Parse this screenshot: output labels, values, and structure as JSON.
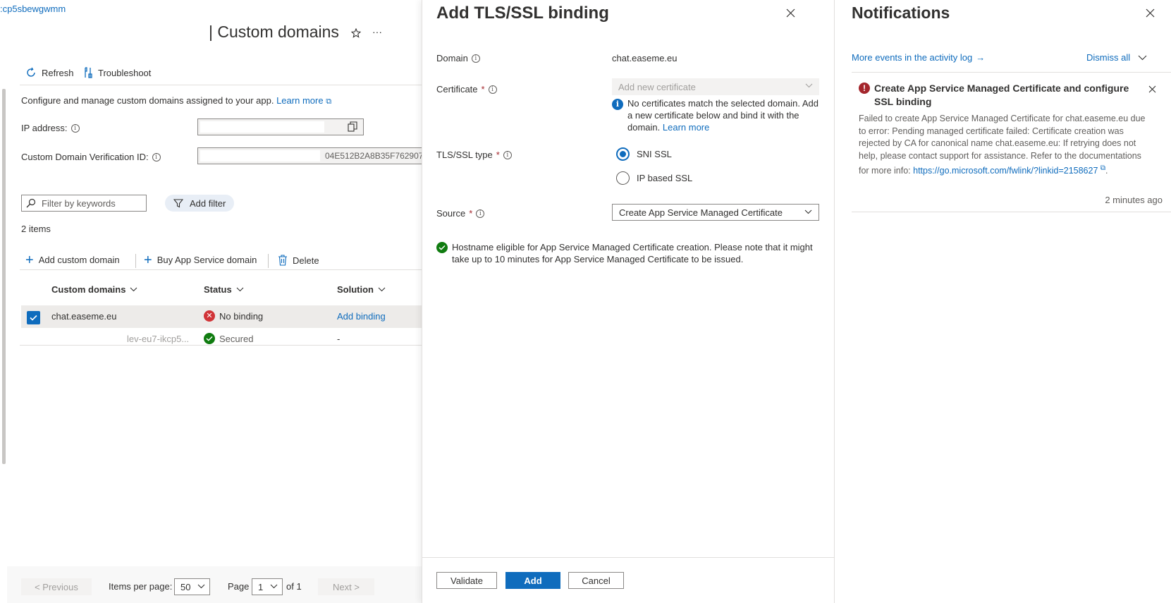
{
  "left": {
    "breadcrumb": ":cp5sbewgwmm",
    "title": "| Custom domains",
    "toolbar": {
      "refresh": "Refresh",
      "troubleshoot": "Troubleshoot"
    },
    "description": "Configure and manage custom domains assigned to your app.",
    "learn_more": "Learn more",
    "ip_label": "IP address:",
    "verification_label": "Custom Domain Verification ID:",
    "verification_tail": "04E512B2A8B35F762907",
    "filter_placeholder": "Filter by keywords",
    "add_filter": "Add filter",
    "items_count": "2 items",
    "commands": {
      "add": "Add custom domain",
      "buy": "Buy App Service domain",
      "delete": "Delete"
    },
    "columns": [
      "Custom domains",
      "Status",
      "Solution"
    ],
    "rows": [
      {
        "domain": "chat.easeme.eu",
        "status": "No binding",
        "solution": "Add binding"
      },
      {
        "domain": "lev-eu7-ikcp5...",
        "status": "Secured",
        "solution": "-"
      }
    ],
    "pager": {
      "previous": "< Previous",
      "items_per_page_label": "Items per page:",
      "items_per_page": "50",
      "page_label": "Page",
      "page": "1",
      "of": "of 1",
      "next": "Next >"
    }
  },
  "tls": {
    "title": "Add TLS/SSL binding",
    "domain_label": "Domain",
    "domain_value": "chat.easeme.eu",
    "certificate_label": "Certificate",
    "required_mark": "*",
    "certificate_placeholder": "Add new certificate",
    "no_cert_msg": "No certificates match the selected domain. Add a new certificate below and bind it with the domain.",
    "learn_more": "Learn more",
    "type_label": "TLS/SSL type",
    "type_options": [
      "SNI SSL",
      "IP based SSL"
    ],
    "source_label": "Source",
    "source_value": "Create App Service Managed Certificate",
    "eligible_msg": "Hostname eligible for App Service Managed Certificate creation. Please note that it might take up to 10 minutes for App Service Managed Certificate to be issued.",
    "buttons": {
      "validate": "Validate",
      "add": "Add",
      "cancel": "Cancel"
    }
  },
  "notifications": {
    "title": "Notifications",
    "activity_link": "More events in the activity log",
    "arrow": "→",
    "dismiss_all": "Dismiss all",
    "item": {
      "title": "Create App Service Managed Certificate and configure SSL binding",
      "body": "Failed to create App Service Managed Certificate for chat.easeme.eu due to error: Pending managed certificate failed: Certificate creation was rejected by CA for canonical name chat.easeme.eu:  If retrying does not help, please contact support for assistance. Refer to the documentations for more info:",
      "link": "https://go.microsoft.com/fwlink/?linkid=2158627",
      "link_suffix": ".",
      "time": "2 minutes ago"
    }
  },
  "colors": {
    "accent": "#0f6cbd",
    "error": "#a4262c",
    "success": "#107c10",
    "error_status": "#d13438"
  }
}
